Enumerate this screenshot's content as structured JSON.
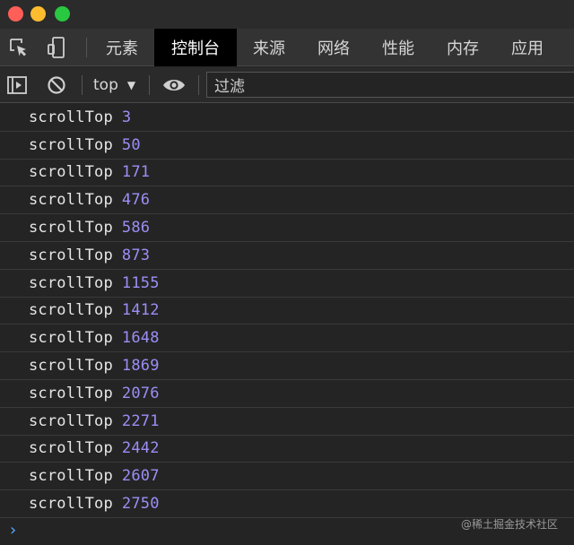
{
  "window": {
    "controls": [
      "close",
      "minimize",
      "maximize"
    ]
  },
  "tabbar": {
    "tools": [
      "inspect-element-icon",
      "device-toolbar-icon"
    ],
    "tabs": [
      {
        "label": "元素",
        "active": false
      },
      {
        "label": "控制台",
        "active": true
      },
      {
        "label": "来源",
        "active": false
      },
      {
        "label": "网络",
        "active": false
      },
      {
        "label": "性能",
        "active": false
      },
      {
        "label": "内存",
        "active": false
      },
      {
        "label": "应用",
        "active": false
      }
    ]
  },
  "toolbar": {
    "icons": [
      "sidebar-toggle-icon",
      "clear-console-icon",
      "eye-icon"
    ],
    "context": "top",
    "filter_placeholder": "过滤"
  },
  "console": {
    "label": "scrollTop",
    "values": [
      "3",
      "50",
      "171",
      "476",
      "586",
      "873",
      "1155",
      "1412",
      "1648",
      "1869",
      "2076",
      "2271",
      "2442",
      "2607",
      "2750"
    ],
    "number_color": "#9c8ef6"
  },
  "prompt": {
    "symbol": "›"
  },
  "watermark": "@稀土掘金技术社区"
}
